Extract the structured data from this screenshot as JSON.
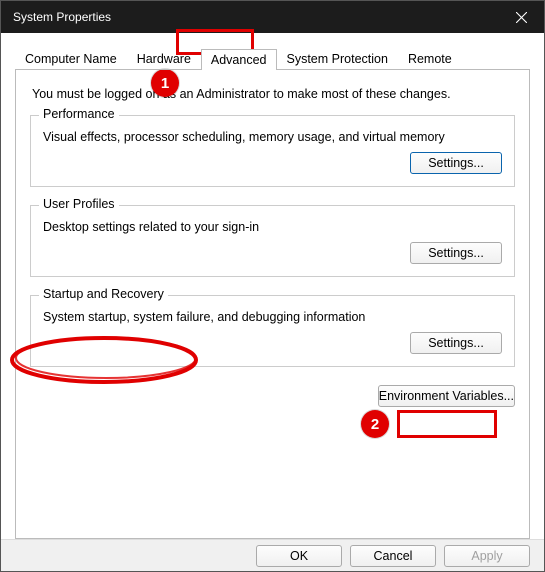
{
  "titlebar": {
    "title": "System Properties"
  },
  "tabs": [
    {
      "label": "Computer Name",
      "active": false
    },
    {
      "label": "Hardware",
      "active": false
    },
    {
      "label": "Advanced",
      "active": true
    },
    {
      "label": "System Protection",
      "active": false
    },
    {
      "label": "Remote",
      "active": false
    }
  ],
  "intro": "You must be logged on as an Administrator to make most of these changes.",
  "groups": {
    "performance": {
      "legend": "Performance",
      "text": "Visual effects, processor scheduling, memory usage, and virtual memory",
      "button": "Settings..."
    },
    "userprofiles": {
      "legend": "User Profiles",
      "text": "Desktop settings related to your sign-in",
      "button": "Settings..."
    },
    "startup": {
      "legend": "Startup and Recovery",
      "text": "System startup, system failure, and debugging information",
      "button": "Settings..."
    }
  },
  "env_button": "Environment Variables...",
  "footer": {
    "ok": "OK",
    "cancel": "Cancel",
    "apply": "Apply"
  },
  "annotations": {
    "badge1": "1",
    "badge2": "2"
  }
}
